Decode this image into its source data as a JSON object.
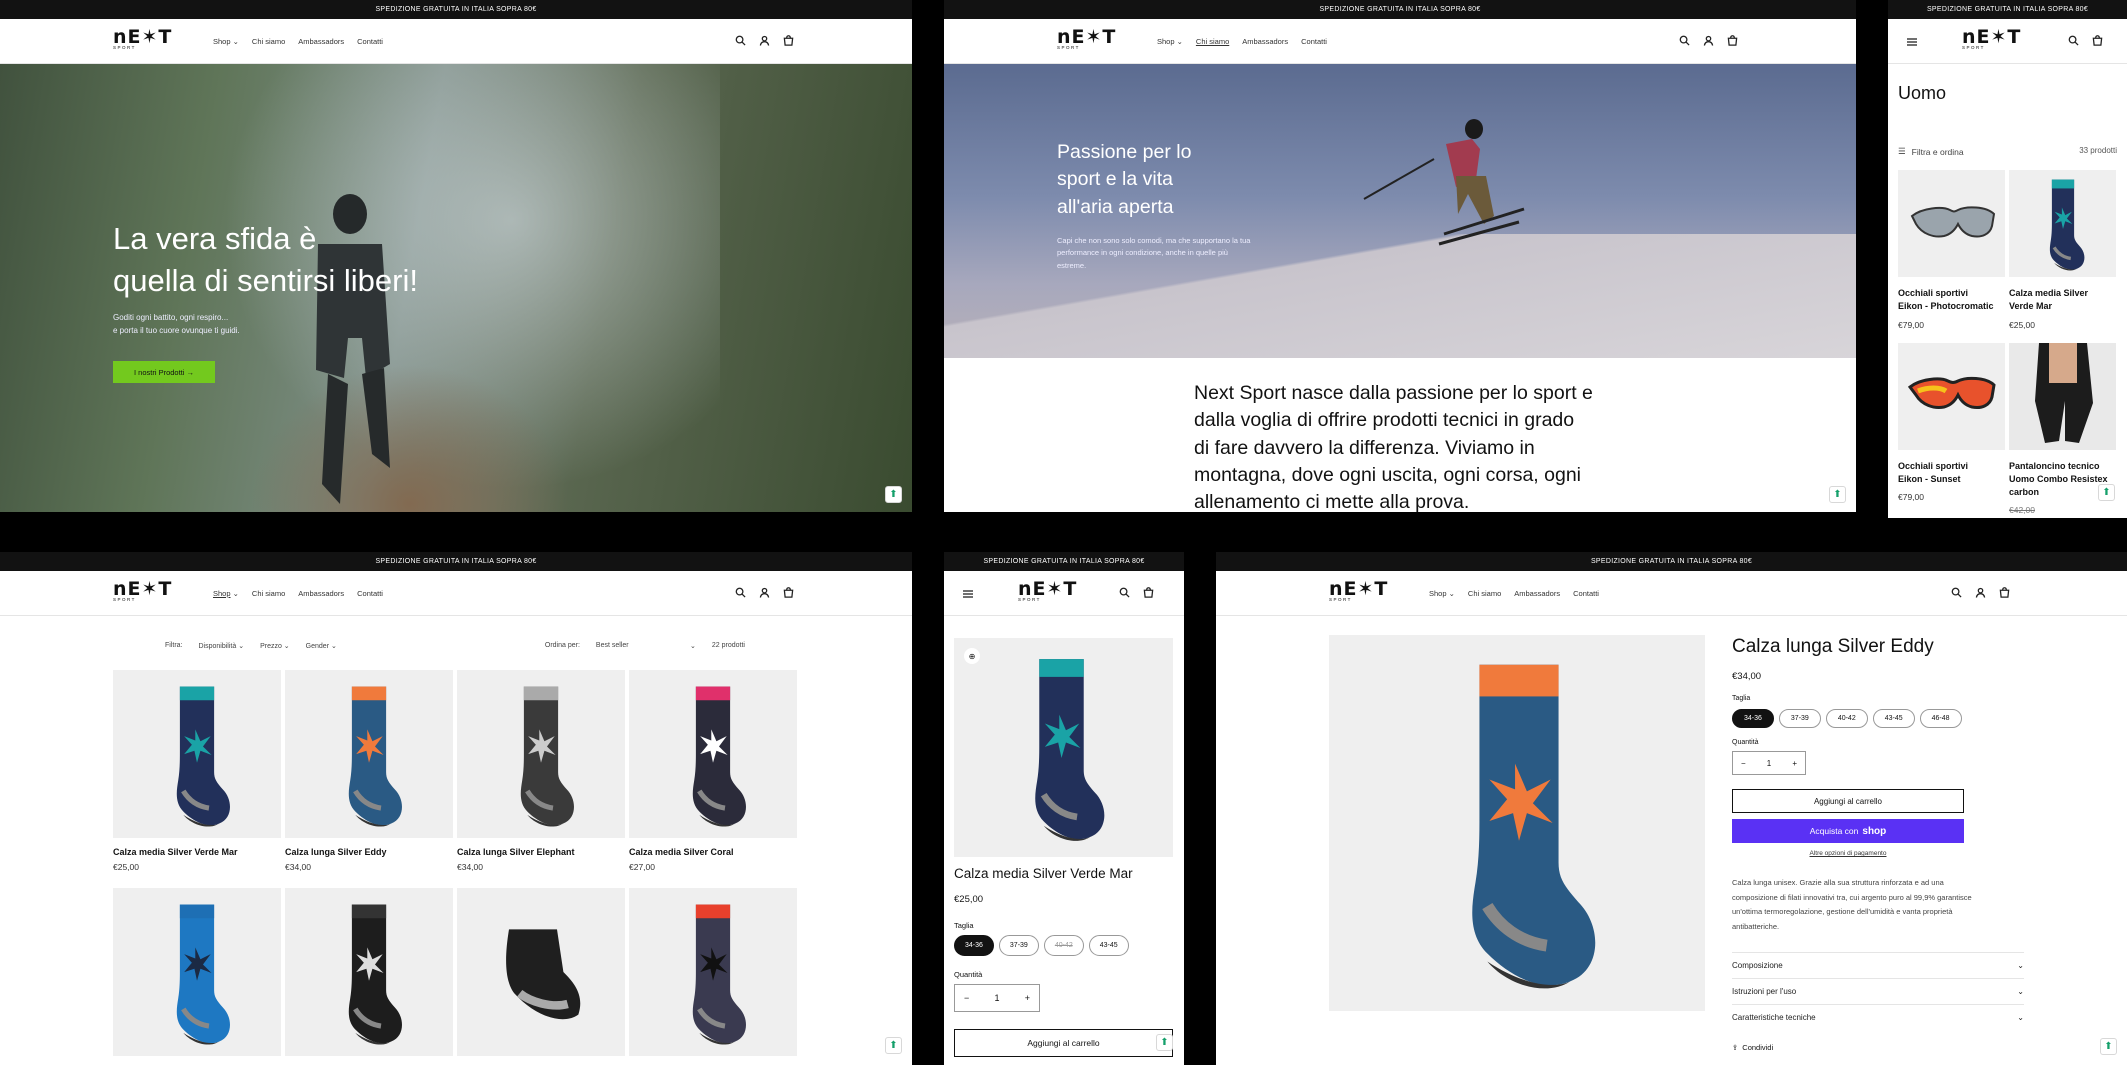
{
  "announcement": "SPEDIZIONE GRATUITA IN ITALIA SOPRA 80€",
  "brand": {
    "logo_word": "nE✶T",
    "logo_sub": "SPORT"
  },
  "nav": {
    "shop": "Shop",
    "chi_siamo": "Chi siamo",
    "ambassadors": "Ambassadors",
    "contatti": "Contatti"
  },
  "icons": {
    "search": "search-icon",
    "account": "account-icon",
    "cart": "cart-icon",
    "menu": "menu-icon",
    "chevron": "chevron-down-icon",
    "filter": "filter-icon",
    "share": "share-icon",
    "zoom": "zoom-icon"
  },
  "home": {
    "hero_line1": "La vera sfida è",
    "hero_line2": "quella di sentirsi liberi!",
    "sub_line1": "Goditi ogni battito, ogni respiro...",
    "sub_line2": "e porta il tuo cuore ovunque ti guidi.",
    "cta": "I nostri Prodotti →"
  },
  "about": {
    "hero_line1": "Passione per lo",
    "hero_line2": "sport e la vita",
    "hero_line3": "all'aria aperta",
    "sub_line1": "Capi che non sono solo comodi, ma che supportano la tua",
    "sub_line2": "performance in ogni condizione, anche in quelle più",
    "sub_line3": "estreme.",
    "body_line1": "Next Sport nasce dalla passione per lo sport e",
    "body_line2": "dalla voglia di offrire prodotti tecnici in grado",
    "body_line3": "di fare davvero la differenza. Viviamo in",
    "body_line4": "montagna, dove ogni uscita, ogni corsa, ogni",
    "body_line5": "allenamento ci mette alla prova."
  },
  "uomo": {
    "title": "Uomo",
    "filter_label": "Filtra e ordina",
    "count": "33 prodotti",
    "products": [
      {
        "name_l1": "Occhiali sportivi",
        "name_l2": "Eikon - Photocromatic",
        "price": "€79,00"
      },
      {
        "name_l1": "Calza media Silver",
        "name_l2": "Verde Mar",
        "price": "€25,00"
      },
      {
        "name_l1": "Occhiali sportivi",
        "name_l2": "Eikon - Sunset",
        "price": "€79,00"
      },
      {
        "name_l1": "Pantaloncino tecnico",
        "name_l2": "Uomo Combo Resistex",
        "name_l3": "carbon",
        "price": "€42,00"
      }
    ]
  },
  "shop": {
    "filter_label": "Filtra:",
    "f1": "Disponibilità",
    "f2": "Prezzo",
    "f3": "Gender",
    "sort_label": "Ordina per:",
    "sort_value": "Best seller",
    "count": "22 prodotti",
    "products": [
      {
        "name": "Calza media Silver Verde Mar",
        "price": "€25,00"
      },
      {
        "name": "Calza lunga Silver Eddy",
        "price": "€34,00"
      },
      {
        "name": "Calza lunga Silver Elephant",
        "price": "€34,00"
      },
      {
        "name": "Calza media Silver Coral",
        "price": "€27,00"
      }
    ]
  },
  "pdp_mobile": {
    "title": "Calza media Silver Verde Mar",
    "price": "€25,00",
    "size_label": "Taglia",
    "sizes": [
      "34-36",
      "37-39",
      "40-42",
      "43-45"
    ],
    "qty_label": "Quantità",
    "qty": "1",
    "add_to_cart": "Aggiungi al carrello"
  },
  "pdp": {
    "title": "Calza lunga Silver Eddy",
    "price": "€34,00",
    "size_label": "Taglia",
    "sizes": [
      "34-36",
      "37-39",
      "40-42",
      "43-45",
      "46-48"
    ],
    "qty_label": "Quantità",
    "qty": "1",
    "add_to_cart": "Aggiungi al carrello",
    "buy_now": "Acquista con",
    "shop_word": "shop",
    "more_payment": "Altre opzioni di pagamento",
    "desc_l1": "Calza lunga unisex. Grazie alla sua struttura rinforzata e ad una",
    "desc_l2": "composizione di filati innovativi tra, cui argento puro al 99,9% garantisce",
    "desc_l3": "un'ottima termoregolazione, gestione dell'umidità e vanta proprietà",
    "desc_l4": "antibatteriche.",
    "acc1": "Composizione",
    "acc2": "Istruzioni per l'uso",
    "acc3": "Caratteristiche tecniche",
    "share": "Condividi"
  },
  "colors": {
    "accent_green": "#73c91e",
    "shop_pay": "#5a31f4",
    "dark": "#121212"
  }
}
